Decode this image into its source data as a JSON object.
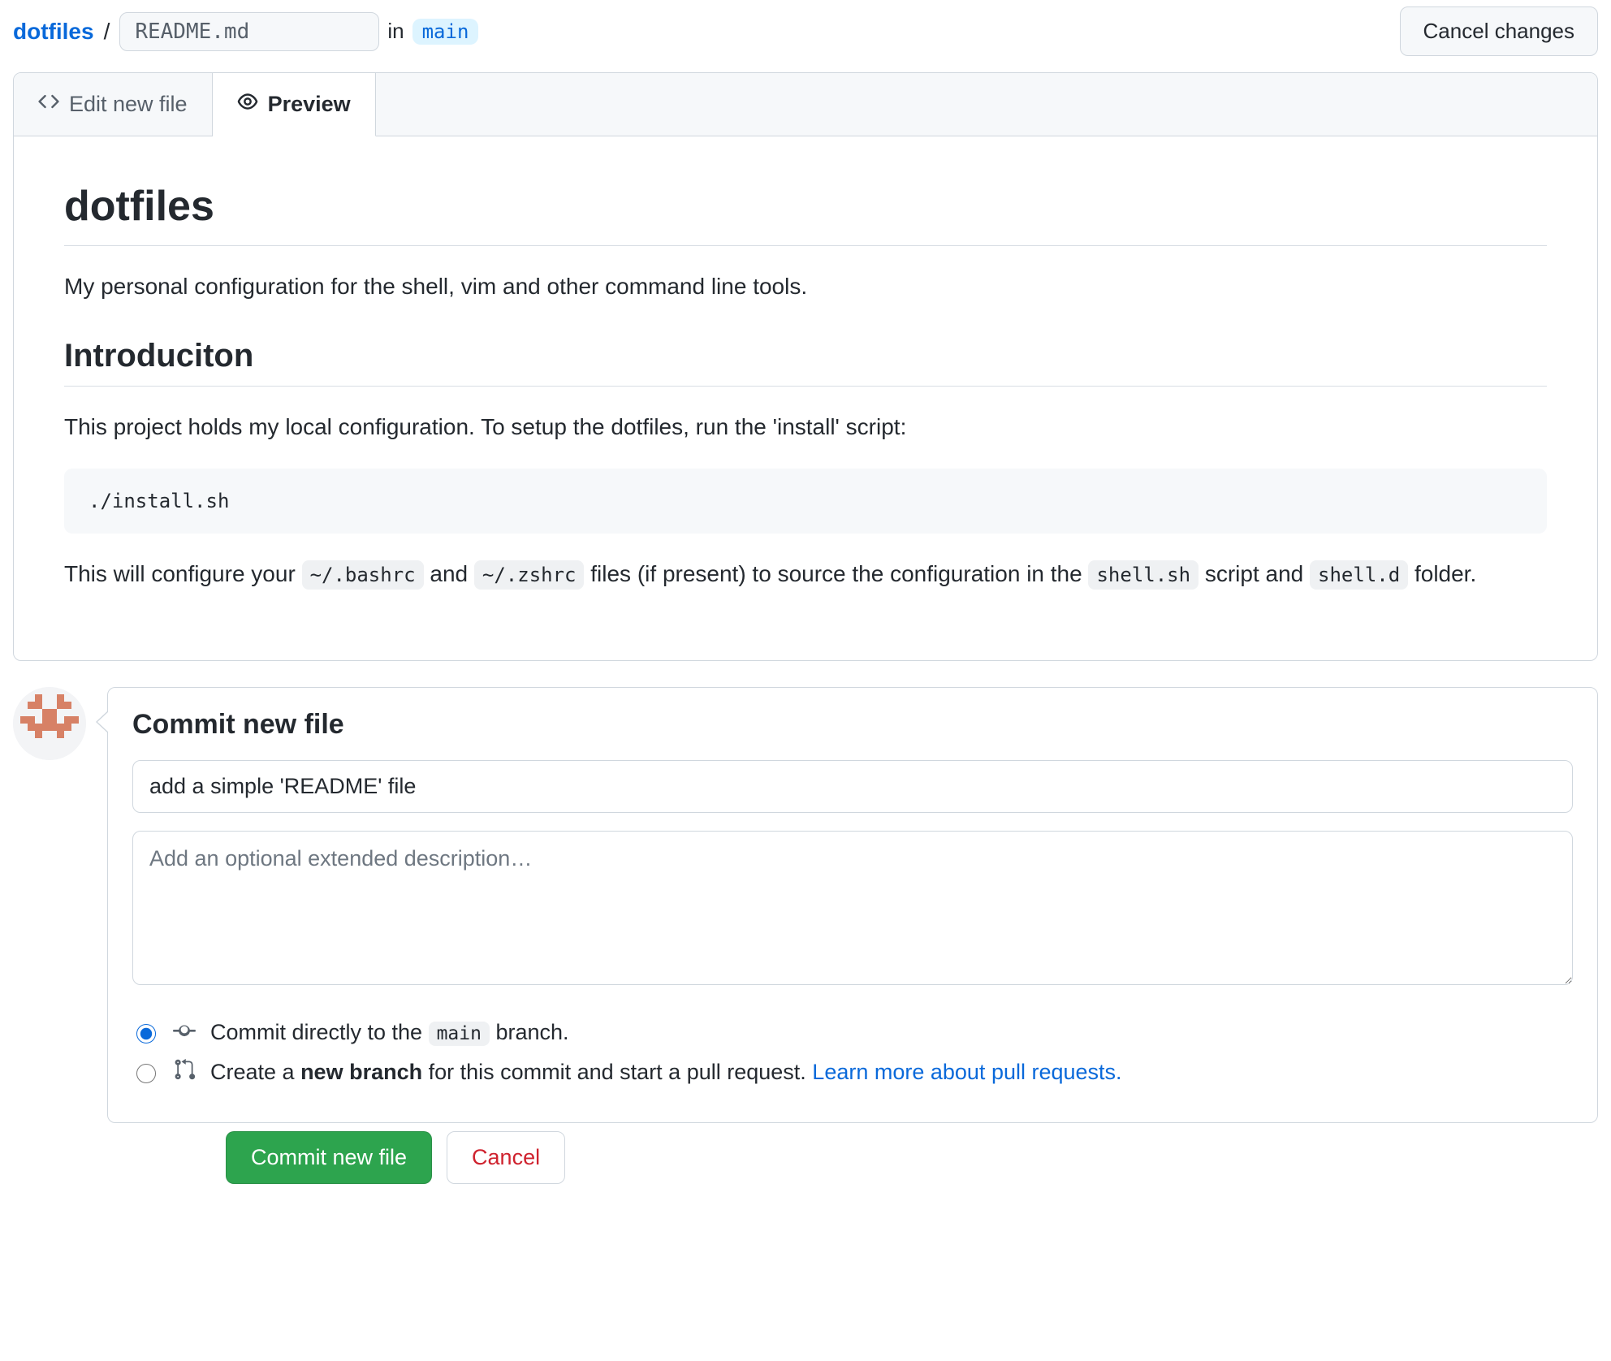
{
  "breadcrumb": {
    "repo": "dotfiles",
    "filename_value": "README.md",
    "in_label": "in",
    "branch": "main"
  },
  "cancel_changes_label": "Cancel changes",
  "tabs": {
    "edit": "Edit new file",
    "preview": "Preview"
  },
  "readme": {
    "h1": "dotfiles",
    "p1": "My personal configuration for the shell, vim and other command line tools.",
    "h2": "Introduciton",
    "p2": "This project holds my local configuration. To setup the dotfiles, run the 'install' script:",
    "code_block": "./install.sh",
    "p3_a": "This will configure your ",
    "code1": "~/.bashrc",
    "p3_b": " and ",
    "code2": "~/.zshrc",
    "p3_c": " files (if present) to source the configuration in the ",
    "code3": "shell.sh",
    "p3_d": " script and ",
    "code4": "shell.d",
    "p3_e": " folder."
  },
  "commit": {
    "heading": "Commit new file",
    "summary_value": "add a simple 'README' file",
    "desc_placeholder": "Add an optional extended description…",
    "radio_direct_a": "Commit directly to the ",
    "radio_direct_branch": "main",
    "radio_direct_b": " branch.",
    "radio_new_a": "Create a ",
    "radio_new_bold": "new branch",
    "radio_new_b": " for this commit and start a pull request. ",
    "radio_new_link": "Learn more about pull requests.",
    "submit_label": "Commit new file",
    "cancel_label": "Cancel"
  }
}
